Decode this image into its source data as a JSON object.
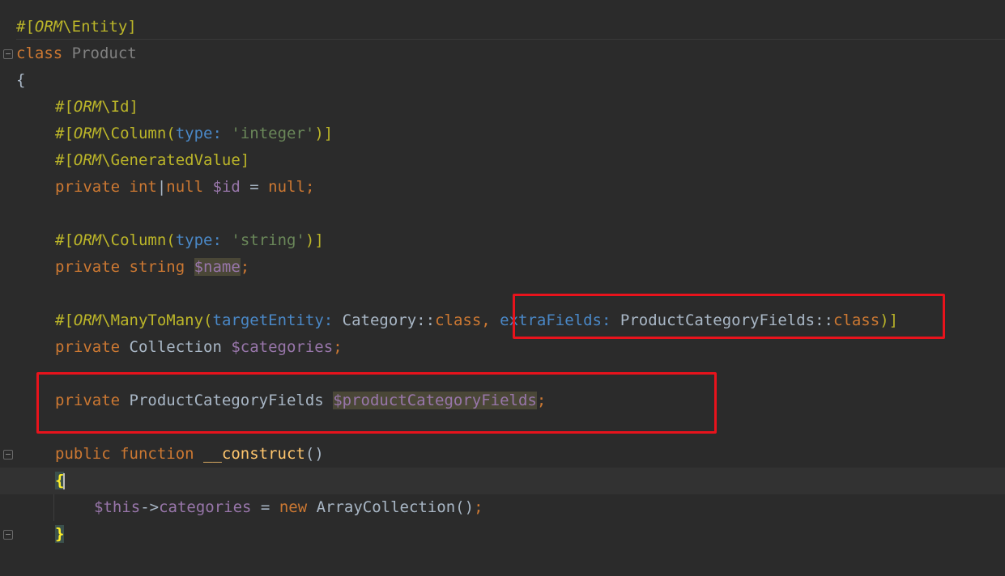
{
  "code": {
    "l1": {
      "hash": "#[",
      "orm": "ORM",
      "rest": "\\Entity]"
    },
    "l2": {
      "kw": "class ",
      "name": "Product"
    },
    "l3": {
      "brace": "{"
    },
    "l4": {
      "hash": "#[",
      "orm": "ORM",
      "rest": "\\Id]"
    },
    "l5": {
      "hash": "#[",
      "orm": "ORM",
      "pre": "\\Column(",
      "p1": "type:",
      "sp": " ",
      "s1": "'integer'",
      "post": ")]"
    },
    "l6": {
      "hash": "#[",
      "orm": "ORM",
      "rest": "\\GeneratedValue]"
    },
    "l7": {
      "kw1": "private ",
      "type1": "int",
      "pipe": "|",
      "type2": "null",
      "sp": " ",
      "var": "$id",
      "eq": " = ",
      "nul": "null",
      "semi": ";"
    },
    "l8": {
      "hash": "#[",
      "orm": "ORM",
      "pre": "\\Column(",
      "p1": "type:",
      "sp": " ",
      "s1": "'string'",
      "post": ")]"
    },
    "l9": {
      "kw1": "private string ",
      "var": "$name",
      "semi": ";"
    },
    "l10": {
      "hash": "#[",
      "orm": "ORM",
      "pre": "\\ManyToMany(",
      "p1": "targetEntity:",
      "c1": " Category::",
      "k1": "class",
      "comma": ", ",
      "p2": "extraFields:",
      "c2": " ProductCategoryFields::",
      "k2": "class",
      "post": ")]"
    },
    "l11": {
      "kw1": "private ",
      "cls": "Collection ",
      "var": "$categories",
      "semi": ";"
    },
    "l12": {
      "kw1": "private ",
      "cls": "ProductCategoryFields ",
      "var": "$productCategoryFields",
      "semi": ";"
    },
    "l13": {
      "kw1": "public function ",
      "fn": "__construct",
      "parens": "()"
    },
    "l14": {
      "brace": "{"
    },
    "l15": {
      "var": "$this",
      "arrow": "->",
      "prop": "categories",
      "eq": " = ",
      "kw": "new ",
      "cls": "ArrayCollection",
      "parens": "()",
      "semi": ";"
    },
    "l16": {
      "brace": "}"
    }
  }
}
